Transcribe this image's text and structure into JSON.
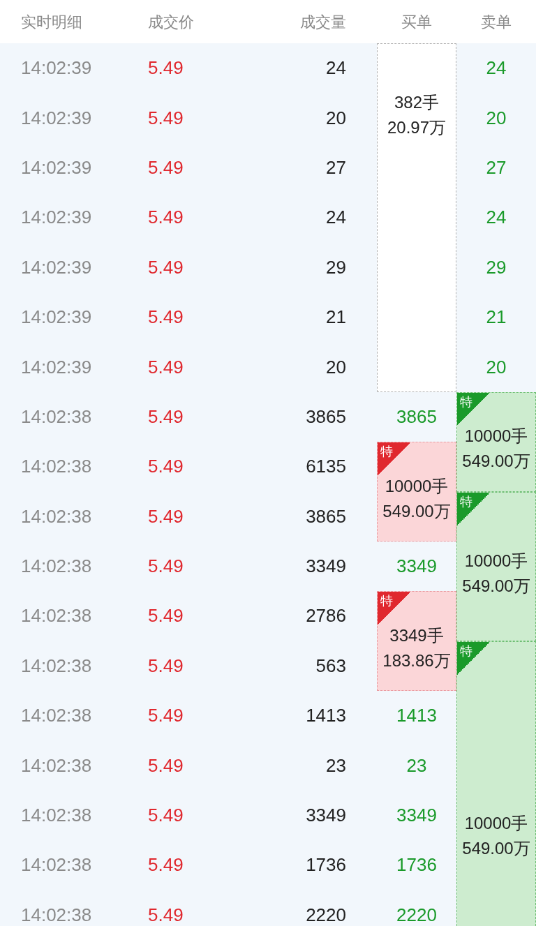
{
  "columns": [
    "实时明细",
    "成交价",
    "成交量",
    "买单",
    "卖单"
  ],
  "rows": [
    {
      "time": "14:02:39",
      "price": "5.49",
      "volume": "24",
      "buy": {
        "kind": "block",
        "special": false,
        "shares": "382手",
        "amount": "20.97万"
      },
      "sell": {
        "kind": "value",
        "text": "24"
      }
    },
    {
      "time": "14:02:39",
      "price": "5.49",
      "volume": "20",
      "buy": {
        "kind": "continued"
      },
      "sell": {
        "kind": "value",
        "text": "20"
      }
    },
    {
      "time": "14:02:39",
      "price": "5.49",
      "volume": "27",
      "buy": {
        "kind": "continued"
      },
      "sell": {
        "kind": "value",
        "text": "27"
      }
    },
    {
      "time": "14:02:39",
      "price": "5.49",
      "volume": "24",
      "buy": {
        "kind": "continued"
      },
      "sell": {
        "kind": "value",
        "text": "24"
      }
    },
    {
      "time": "14:02:39",
      "price": "5.49",
      "volume": "29",
      "buy": {
        "kind": "continued"
      },
      "sell": {
        "kind": "value",
        "text": "29"
      }
    },
    {
      "time": "14:02:39",
      "price": "5.49",
      "volume": "21",
      "buy": {
        "kind": "continued"
      },
      "sell": {
        "kind": "value",
        "text": "21"
      }
    },
    {
      "time": "14:02:39",
      "price": "5.49",
      "volume": "20",
      "buy": {
        "kind": "continued"
      },
      "sell": {
        "kind": "value",
        "text": "20"
      }
    },
    {
      "time": "14:02:38",
      "price": "5.49",
      "volume": "3865",
      "buy": {
        "kind": "value",
        "text": "3865"
      },
      "sell": {
        "kind": "block",
        "special": true,
        "tag": "特",
        "shares": "10000手",
        "amount": "549.00万"
      }
    },
    {
      "time": "14:02:38",
      "price": "5.49",
      "volume": "6135",
      "buy": {
        "kind": "block",
        "special": true,
        "tag": "特",
        "shares": "10000手",
        "amount": "549.00万"
      },
      "sell": {
        "kind": "continued"
      }
    },
    {
      "time": "14:02:38",
      "price": "5.49",
      "volume": "3865",
      "buy": {
        "kind": "continued"
      },
      "sell": {
        "kind": "block",
        "special": true,
        "tag": "特",
        "shares": "10000手",
        "amount": "549.00万"
      }
    },
    {
      "time": "14:02:38",
      "price": "5.49",
      "volume": "3349",
      "buy": {
        "kind": "value",
        "text": "3349"
      },
      "sell": {
        "kind": "continued"
      }
    },
    {
      "time": "14:02:38",
      "price": "5.49",
      "volume": "2786",
      "buy": {
        "kind": "block",
        "special": true,
        "tag": "特",
        "shares": "3349手",
        "amount": "183.86万"
      },
      "sell": {
        "kind": "continued"
      }
    },
    {
      "time": "14:02:38",
      "price": "5.49",
      "volume": "563",
      "buy": {
        "kind": "continued"
      },
      "sell": {
        "kind": "block",
        "special": true,
        "tag": "特",
        "shares": "10000手",
        "amount": "549.00万"
      }
    },
    {
      "time": "14:02:38",
      "price": "5.49",
      "volume": "1413",
      "buy": {
        "kind": "value",
        "text": "1413"
      },
      "sell": {
        "kind": "continued"
      }
    },
    {
      "time": "14:02:38",
      "price": "5.49",
      "volume": "23",
      "buy": {
        "kind": "value",
        "text": "23"
      },
      "sell": {
        "kind": "continued"
      }
    },
    {
      "time": "14:02:38",
      "price": "5.49",
      "volume": "3349",
      "buy": {
        "kind": "value",
        "text": "3349"
      },
      "sell": {
        "kind": "continued"
      }
    },
    {
      "time": "14:02:38",
      "price": "5.49",
      "volume": "1736",
      "buy": {
        "kind": "value",
        "text": "1736"
      },
      "sell": {
        "kind": "continued"
      }
    },
    {
      "time": "14:02:38",
      "price": "5.49",
      "volume": "2220",
      "buy": {
        "kind": "value",
        "text": "2220"
      },
      "sell": {
        "kind": "continued"
      }
    }
  ]
}
